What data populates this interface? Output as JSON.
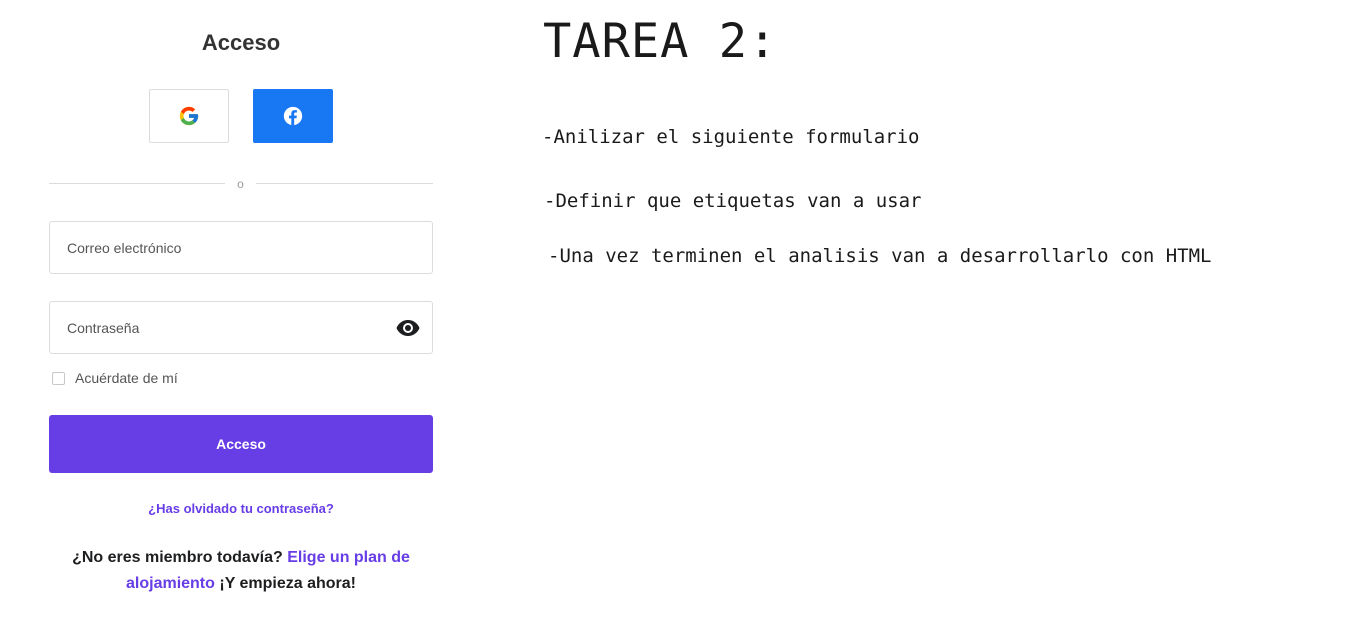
{
  "login": {
    "title": "Acceso",
    "google_icon": "google-icon",
    "facebook_icon": "facebook-icon",
    "divider_text": "o",
    "email_placeholder": "Correo electrónico",
    "password_placeholder": "Contraseña",
    "eye_icon": "eye-icon",
    "remember_label": "Acuérdate de mí",
    "submit_label": "Acceso",
    "forgot_link": "¿Has olvidado tu contraseña?",
    "signup_prefix": "¿No eres miembro todavía?",
    "signup_link_1": "Elige un plan de",
    "signup_link_2": "alojamiento",
    "signup_suffix": "¡Y empieza ahora!"
  },
  "task": {
    "title": "TAREA 2:",
    "lines": [
      "-Anilizar el siguiente formulario",
      "-Definir que etiquetas van a usar",
      "-Una vez terminen el analisis van a desarrollarlo con HTML"
    ]
  },
  "colors": {
    "primary": "#673de6",
    "facebook": "#1877f2",
    "text_dark": "#1d1e20"
  }
}
